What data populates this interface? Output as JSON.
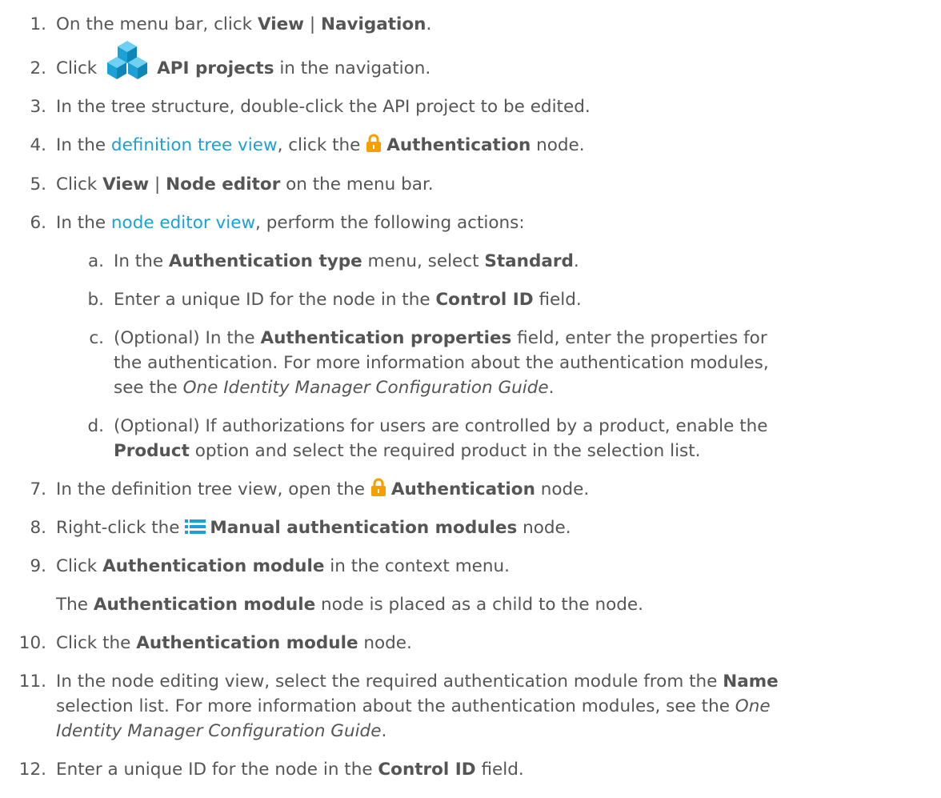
{
  "colors": {
    "text": "#555555",
    "link": "#1ba1d6",
    "icon_blue": "#1ba1d6",
    "icon_orange": "#f5a000"
  },
  "steps": [
    {
      "num": "1.",
      "t1": "On the menu bar, click ",
      "b1": "View",
      "t2": " | ",
      "b2": "Navigation",
      "t3": "."
    },
    {
      "num": "2.",
      "t1": "Click ",
      "icon": "api-projects-icon",
      "b1": "API projects",
      "t2": " in the navigation."
    },
    {
      "num": "3.",
      "t1": "In the tree structure, double-click the API project to be edited."
    },
    {
      "num": "4.",
      "t1": "In the ",
      "link": "definition tree view",
      "t2": ", click the ",
      "icon": "lock-icon",
      "b1": "Authentication",
      "t3": " node."
    },
    {
      "num": "5.",
      "t1": "Click ",
      "b1": "View",
      "t2": " | ",
      "b2": "Node editor",
      "t3": " on the menu bar."
    },
    {
      "num": "6.",
      "t1": "In the ",
      "link": "node editor view",
      "t2": ", perform the following actions:"
    },
    {
      "num": "7.",
      "t1": "In the definition tree view, open the ",
      "icon": "lock-icon",
      "b1": "Authentication",
      "t2": " node."
    },
    {
      "num": "8.",
      "t1": "Right-click the ",
      "icon": "list-icon",
      "b1": "Manual authentication modules",
      "t2": " node."
    },
    {
      "num": "9.",
      "t1": "Click ",
      "b1": "Authentication module",
      "t2": " in the context menu.",
      "p_t1": "The ",
      "p_b1": "Authentication module",
      "p_t2": " node is placed as a child to the node."
    },
    {
      "num": "10.",
      "t1": "Click the ",
      "b1": "Authentication module",
      "t2": " node."
    },
    {
      "num": "11.",
      "t1": "In the node editing view, select the required authentication module from the ",
      "b1": "Name",
      "l2": "selection list. For more information about the authentication modules, see the ",
      "i2": "One",
      "l3i": "Identity Manager Configuration Guide",
      "l3": "."
    },
    {
      "num": "12.",
      "t1": "Enter a unique ID for the node in the ",
      "b1": "Control ID",
      "t2": " field."
    }
  ],
  "substeps": [
    {
      "num": "a.",
      "t1": "In the ",
      "b1": "Authentication type",
      "t2": " menu, select ",
      "b2": "Standard",
      "t3": "."
    },
    {
      "num": "b.",
      "t1": "Enter a unique ID for the node in the ",
      "b1": "Control ID",
      "t2": " field."
    },
    {
      "num": "c.",
      "t1": "(Optional) In the ",
      "b1": "Authentication properties",
      "t2": " field, enter the properties for",
      "l2": "the authentication. For more information about the authentication modules,",
      "l3": "see the ",
      "i3": "One Identity Manager Configuration Guide",
      "l3b": "."
    },
    {
      "num": "d.",
      "t1": "(Optional) If authorizations for users are controlled by a product, enable the",
      "b2": "Product",
      "l2": " option and select the required product in the selection list."
    }
  ]
}
